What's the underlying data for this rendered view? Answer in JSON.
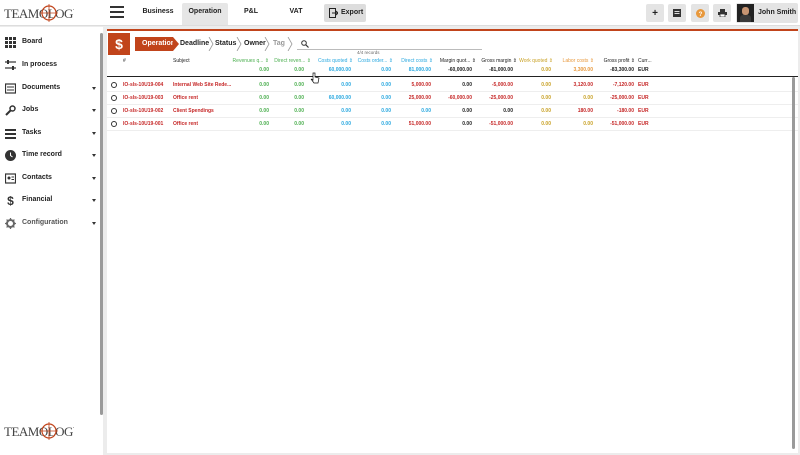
{
  "app": {
    "logo_text": "TEAMOLOGY"
  },
  "nav": {
    "tabs": [
      {
        "label": "Business"
      },
      {
        "label": "Operation"
      },
      {
        "label": "P&L"
      },
      {
        "label": "VAT"
      }
    ],
    "active_tab": "Operation",
    "export_label": "Export",
    "user_name": "John Smith"
  },
  "colors": {
    "accent": "#c1441b",
    "green": "#4caf50",
    "blue": "#29a8e0",
    "gold": "#c9a227",
    "orange": "#e8983c",
    "red": "#c62828"
  },
  "sidebar": {
    "items": [
      {
        "label": "Board",
        "icon": "grid-icon"
      },
      {
        "label": "In process",
        "icon": "sliders-icon"
      },
      {
        "label": "Documents",
        "icon": "document-icon"
      },
      {
        "label": "Jobs",
        "icon": "wrench-icon"
      },
      {
        "label": "Tasks",
        "icon": "list-icon"
      },
      {
        "label": "Time record",
        "icon": "clock-icon"
      },
      {
        "label": "Contacts",
        "icon": "contact-card-icon"
      },
      {
        "label": "Financial",
        "icon": "dollar-icon"
      },
      {
        "label": "Configuration",
        "icon": "gear-icon"
      }
    ]
  },
  "toolbar": {
    "module_icon": "$",
    "crumbs": [
      {
        "label": "Operation"
      },
      {
        "label": "Deadline"
      },
      {
        "label": "Status"
      },
      {
        "label": "Owner"
      },
      {
        "label": "Tag"
      }
    ],
    "records": "4/4 records"
  },
  "table": {
    "headers": {
      "num": "#",
      "subject": "Subject",
      "revenues_q": "Revenues q...",
      "direct_rev": "Direct reven...",
      "costs_quoted": "Costs quoted",
      "costs_ordered": "Costs order...",
      "direct_costs": "Direct costs",
      "margin_quoted": "Margin quot...",
      "gross_margin": "Gross margin",
      "work_quoted": "Work quoted",
      "labor_costs": "Labor costs",
      "gross_profit": "Gross profit",
      "currency": "Curr..."
    },
    "totals": {
      "revenues_q": "0.00",
      "direct_rev": "0.00",
      "costs_quoted": "60,000.00",
      "costs_ordered": "0.00",
      "direct_costs": "81,000.00",
      "margin_quoted": "-60,000.00",
      "gross_margin": "-81,000.00",
      "work_quoted": "0.00",
      "labor_costs": "3,300.00",
      "gross_profit": "-83,300.00",
      "currency": "EUR"
    },
    "rows": [
      {
        "id": "IO-sls-10U19-004",
        "subject": "Internal Web Site Rede...",
        "revenues_q": "0.00",
        "direct_rev": "0.00",
        "costs_quoted": "0.00",
        "costs_ordered": "0.00",
        "direct_costs": "5,000.00",
        "margin_quoted": "0.00",
        "gross_margin": "-5,000.00",
        "work_quoted": "0.00",
        "labor_costs": "3,120.00",
        "gross_profit": "-7,120.00",
        "currency": "EUR"
      },
      {
        "id": "IO-sls-10U19-003",
        "subject": "Office rent",
        "revenues_q": "0.00",
        "direct_rev": "0.00",
        "costs_quoted": "60,000.00",
        "costs_ordered": "0.00",
        "direct_costs": "25,000.00",
        "margin_quoted": "-60,000.00",
        "gross_margin": "-25,000.00",
        "work_quoted": "0.00",
        "labor_costs": "0.00",
        "gross_profit": "-25,000.00",
        "currency": "EUR"
      },
      {
        "id": "IO-sls-10U19-002",
        "subject": "Client Spendings",
        "revenues_q": "0.00",
        "direct_rev": "0.00",
        "costs_quoted": "0.00",
        "costs_ordered": "0.00",
        "direct_costs": "0.00",
        "margin_quoted": "0.00",
        "gross_margin": "0.00",
        "work_quoted": "0.00",
        "labor_costs": "180.00",
        "gross_profit": "-180.00",
        "currency": "EUR"
      },
      {
        "id": "IO-sls-10U19-001",
        "subject": "Office rent",
        "revenues_q": "0.00",
        "direct_rev": "0.00",
        "costs_quoted": "0.00",
        "costs_ordered": "0.00",
        "direct_costs": "51,000.00",
        "margin_quoted": "0.00",
        "gross_margin": "-51,000.00",
        "work_quoted": "0.00",
        "labor_costs": "0.00",
        "gross_profit": "-51,000.00",
        "currency": "EUR"
      }
    ]
  }
}
